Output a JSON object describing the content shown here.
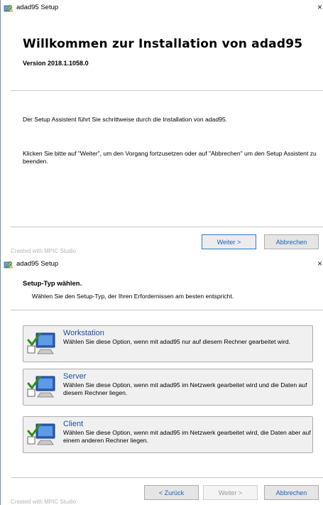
{
  "window1": {
    "title": "adad95 Setup",
    "close_glyph": "×",
    "heading": "Willkommen zur Installation von adad95",
    "version": "Version 2018.1.1058.0",
    "paragraph1": "Der Setup Assistent führt Sie schrittweise durch die Installation von adad95.",
    "paragraph2": "Klicken Sie bitte auf \"Weiter\", um den Vorgang fortzusetzen oder auf \"Abbrechen\" um den Setup Assistent zu beenden.",
    "next_label": "Weiter >",
    "cancel_label": "Abbrechen",
    "footer_text": "Created with MPIC Studio"
  },
  "window2": {
    "title": "adad95 Setup",
    "close_glyph": "×",
    "heading": "Setup-Typ wählen.",
    "subheading": "Wählen Sie den Setup-Typ, der Ihren Erfordernissen am besten entspricht.",
    "options": [
      {
        "title": "Workstation",
        "desc": "Wählen Sie diese Option, wenn mit adad95 nur auf diesem Rechner gearbeitet wird.",
        "icon": "computer-check-icon"
      },
      {
        "title": "Server",
        "desc": "Wählen Sie diese Option, wenn mit adad95 im Netzwerk gearbeitet wird und die Daten auf diesem Rechner liegen.",
        "icon": "computer-check-icon"
      },
      {
        "title": "Client",
        "desc": "Wählen Sie diese Option, wenn mit adad95 im Netzwerk gearbeitet wird, die Daten aber auf einem anderen Rechner liegen.",
        "icon": "computer-check-icon"
      }
    ],
    "back_label": "< Zurück",
    "next_label": "Weiter >",
    "cancel_label": "Abbrechen",
    "footer_text": "Created with MPIC Studio"
  },
  "colors": {
    "link_blue": "#1a63b5",
    "option_title_blue": "#1a4fa0",
    "border": "#acacac"
  }
}
